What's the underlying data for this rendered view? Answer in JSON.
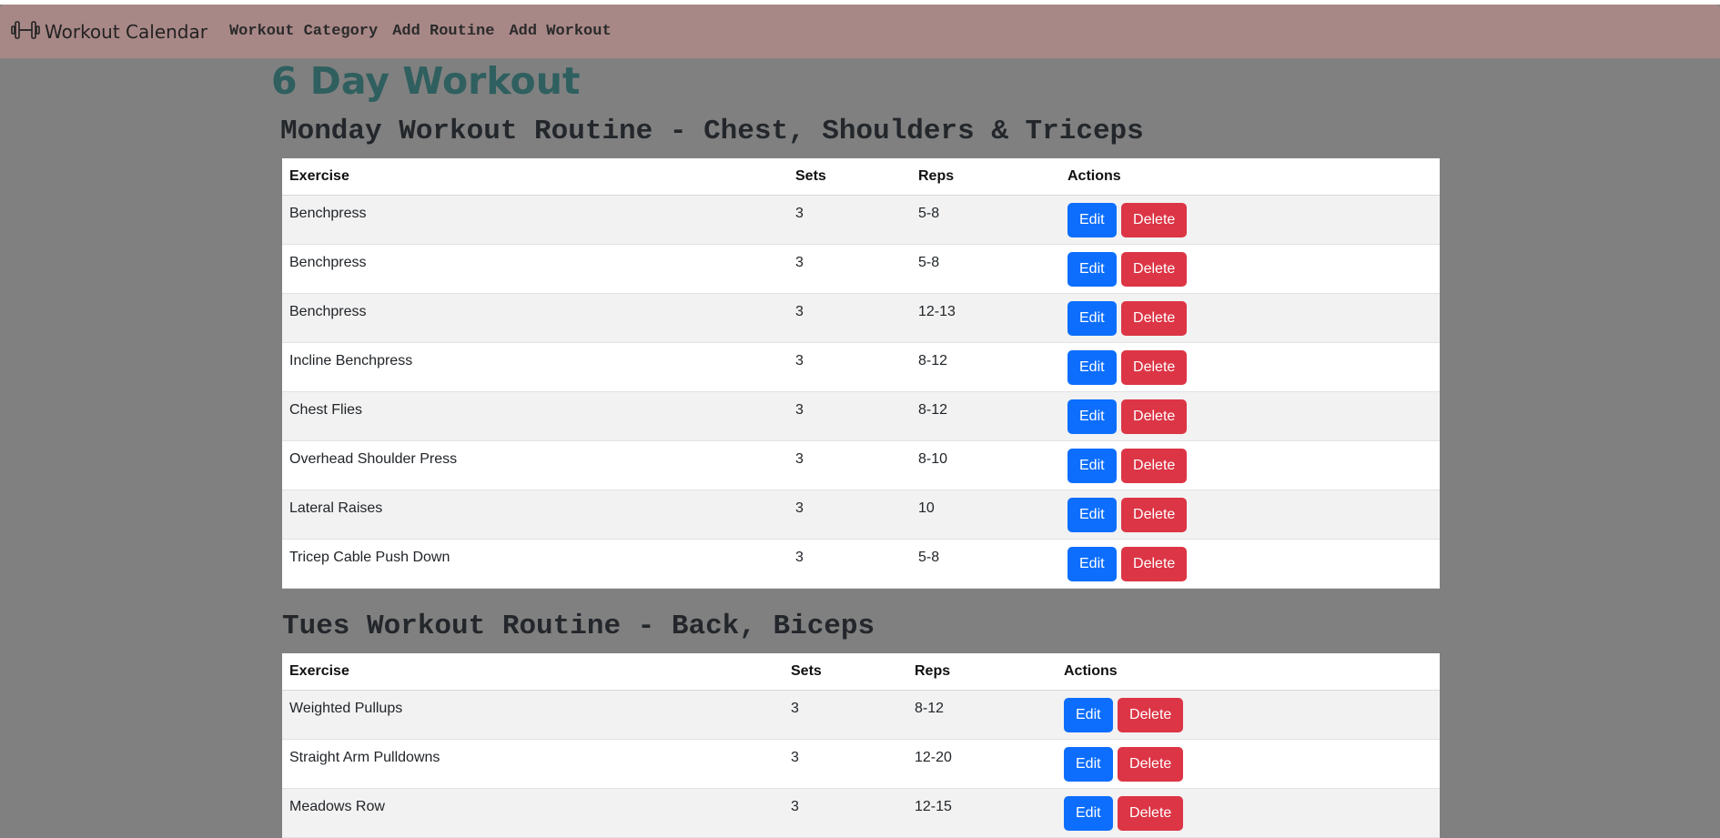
{
  "navbar": {
    "brand": "Workout Calendar",
    "brand_icon": "dumbbell-icon",
    "links": [
      "Workout Category",
      "Add Routine",
      "Add Workout"
    ]
  },
  "page_title": "6 Day Workout",
  "colors": {
    "page_bg": "#808080",
    "navbar_bg": "#a88887",
    "title": "#2f5f5f",
    "edit": "#0d6efd",
    "delete": "#dc3545"
  },
  "routines": [
    {
      "title": "Monday Workout Routine - Chest, Shoulders & Triceps",
      "headers": {
        "exercise": "Exercise",
        "sets": "Sets",
        "reps": "Reps",
        "actions": "Actions"
      },
      "rows": [
        {
          "exercise": "Benchpress",
          "sets": "3",
          "reps": "5-8"
        },
        {
          "exercise": "Benchpress",
          "sets": "3",
          "reps": "5-8"
        },
        {
          "exercise": "Benchpress",
          "sets": "3",
          "reps": "12-13"
        },
        {
          "exercise": "Incline Benchpress",
          "sets": "3",
          "reps": "8-12"
        },
        {
          "exercise": "Chest Flies",
          "sets": "3",
          "reps": "8-12"
        },
        {
          "exercise": "Overhead Shoulder Press",
          "sets": "3",
          "reps": "8-10"
        },
        {
          "exercise": "Lateral Raises",
          "sets": "3",
          "reps": "10"
        },
        {
          "exercise": "Tricep Cable Push Down",
          "sets": "3",
          "reps": "5-8"
        }
      ]
    },
    {
      "title": "Tues Workout Routine - Back, Biceps",
      "headers": {
        "exercise": "Exercise",
        "sets": "Sets",
        "reps": "Reps",
        "actions": "Actions"
      },
      "rows": [
        {
          "exercise": "Weighted Pullups",
          "sets": "3",
          "reps": "8-12"
        },
        {
          "exercise": "Straight Arm Pulldowns",
          "sets": "3",
          "reps": "12-20"
        },
        {
          "exercise": "Meadows Row",
          "sets": "3",
          "reps": "12-15"
        }
      ]
    }
  ],
  "actions": {
    "edit": "Edit",
    "delete": "Delete"
  }
}
